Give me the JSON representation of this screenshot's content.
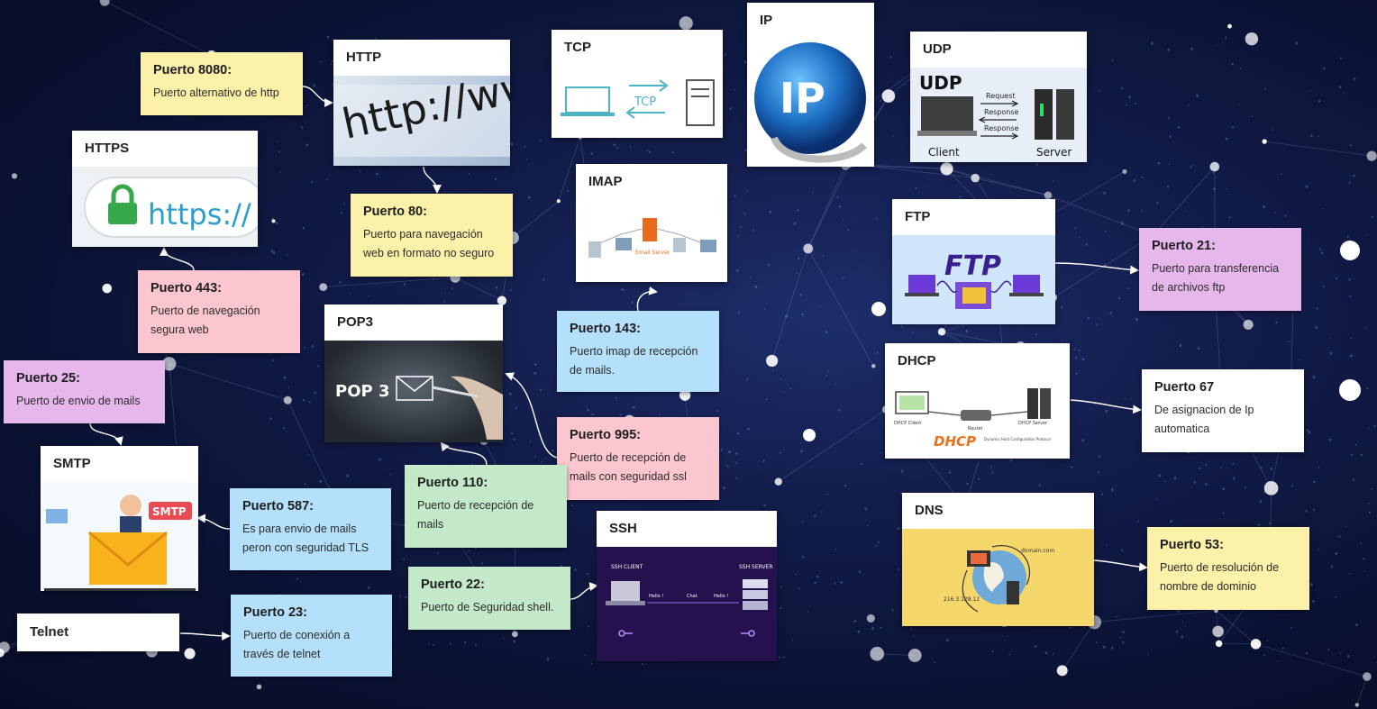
{
  "colors": {
    "background": "#0a1233",
    "note_yellow": "#fbf1a9",
    "note_pink": "#fbc6d0",
    "note_purple": "#e6b7eb",
    "note_blue": "#b4e0fb",
    "note_green": "#c4e9c8",
    "connector": "#ffffff"
  },
  "cards": {
    "https": {
      "title": "HTTPS",
      "image_text": "https://",
      "icon": "padlock-icon"
    },
    "http": {
      "title": "HTTP",
      "image_text": "http://www",
      "icon": "address-bar-icon"
    },
    "tcp": {
      "title": "TCP",
      "image_text": "TCP",
      "icon": "laptop-server-icon"
    },
    "ip": {
      "title": "IP",
      "image_text": "IP",
      "icon": "globe-icon"
    },
    "udp": {
      "title": "UDP",
      "image_text": "UDP",
      "request": "Request",
      "response1": "Response",
      "response2": "Response",
      "client": "Client",
      "server": "Server"
    },
    "imap": {
      "title": "IMAP",
      "image_text": "Email Server",
      "icon": "network-diagram-icon"
    },
    "ftp": {
      "title": "FTP",
      "image_text": "FTP",
      "icon": "folder-icon"
    },
    "pop3": {
      "title": "POP3",
      "image_text": "POP 3",
      "icon": "envelope-icon"
    },
    "dhcp": {
      "title": "DHCP",
      "image_text": "DHCP",
      "client": "DHCP Client",
      "router": "Router",
      "server": "DHCP Server",
      "subtitle": "Dynamic Host Configuration Protocol"
    },
    "smtp": {
      "title": "SMTP",
      "image_text": "SMTP",
      "icon": "mail-envelope-icon"
    },
    "ssh": {
      "title": "SSH",
      "client": "SSH CLIENT",
      "server": "SSH SERVER",
      "hello1": "Hello !",
      "hello2": "Hello !",
      "chat": "Chat",
      "icon": "key-icon"
    },
    "dns": {
      "title": "DNS",
      "domain": "domain.com",
      "ip": "216.3.128.12",
      "icon": "globe-icon"
    }
  },
  "notes": {
    "p8080": {
      "title": "Puerto 8080:",
      "text": "Puerto alternativo de http"
    },
    "p80": {
      "title": "Puerto 80:",
      "text": "Puerto para navegación web en formato no seguro"
    },
    "p443": {
      "title": "Puerto 443:",
      "text": "Puerto de navegación segura web"
    },
    "p25": {
      "title": "Puerto 25:",
      "text": "Puerto de envio de mails"
    },
    "p143": {
      "title": "Puerto 143:",
      "text": "Puerto imap de recepción de mails."
    },
    "p995": {
      "title": "Puerto 995:",
      "text": "Puerto de recepción de mails con seguridad ssl"
    },
    "p110": {
      "title": "Puerto 110:",
      "text": "Puerto de recepción de mails"
    },
    "p587": {
      "title": "Puerto 587:",
      "text": "Es para envio de mails peron con seguridad TLS"
    },
    "p22": {
      "title": "Puerto 22:",
      "text": "Puerto de Seguridad shell."
    },
    "p23": {
      "title": "Puerto 23:",
      "text": "Puerto de conexión a través de telnet"
    },
    "p21": {
      "title": "Puerto 21:",
      "text": "Puerto para transferencia de archivos ftp"
    },
    "p67": {
      "title": "Puerto 67",
      "text": "De asignacion de Ip automatica"
    },
    "p53": {
      "title": "Puerto 53:",
      "text": "Puerto de resolución de nombre de dominio"
    }
  },
  "labels": {
    "telnet": "Telnet"
  }
}
